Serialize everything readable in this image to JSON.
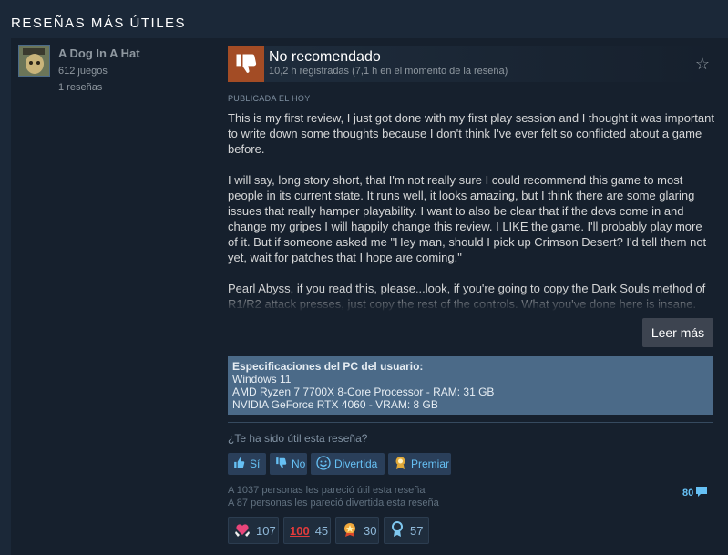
{
  "section_title": "RESEÑAS MÁS ÚTILES",
  "author": {
    "name": "A Dog In A Hat",
    "games": "612 juegos",
    "reviews": "1 reseñas"
  },
  "review": {
    "verdict": "No recomendado",
    "hours": "10,2 h registradas (7,1 h en el momento de la reseña)",
    "posted": "PUBLICADA EL HOY",
    "paragraphs": [
      "This is my first review, I just got done with my first play session and I thought it was important to write down some thoughts because I don't think I've ever felt so conflicted about a game before.",
      "I will say, long story short, that I'm not really sure I could recommend this game to most people in its current state. It runs well, it looks amazing, but I think there are some glaring issues that really hamper playability. I want to also be clear that if the devs come in and change my gripes I will happily change this review. I LIKE the game. I'll probably play more of it. But if someone asked me \"Hey man, should I pick up Crimson Desert? I'd tell them not yet, wait for patches that I hope are coming.\"",
      "Pearl Abyss, if you read this, please...look, if you're going to copy the Dark Souls method of R1/R2 attack presses, just copy the rest of the controls. What you've done here is insane."
    ],
    "read_more": "Leer más",
    "verdict_color": "#a34c25"
  },
  "specs": {
    "heading": "Especificaciones del PC del usuario:",
    "os": "Windows 11",
    "cpu_ram": "AMD Ryzen 7 7700X 8-Core Processor - RAM: 31 GB",
    "gpu": "NVIDIA GeForce RTX 4060 - VRAM: 8 GB"
  },
  "helpful": {
    "question": "¿Te ha sido útil esta reseña?",
    "yes": "Sí",
    "no": "No",
    "funny": "Divertida",
    "award": "Premiar",
    "stat_helpful": "A 1037 personas les pareció útil esta reseña",
    "stat_funny": "A 87 personas les pareció divertida esta reseña",
    "comments": "80"
  },
  "awards": [
    {
      "icon": "heart-hands-icon",
      "count": "107"
    },
    {
      "icon": "hundred-icon",
      "count": "45"
    },
    {
      "icon": "medal-icon",
      "count": "30"
    },
    {
      "icon": "ribbon-icon",
      "count": "57"
    }
  ]
}
